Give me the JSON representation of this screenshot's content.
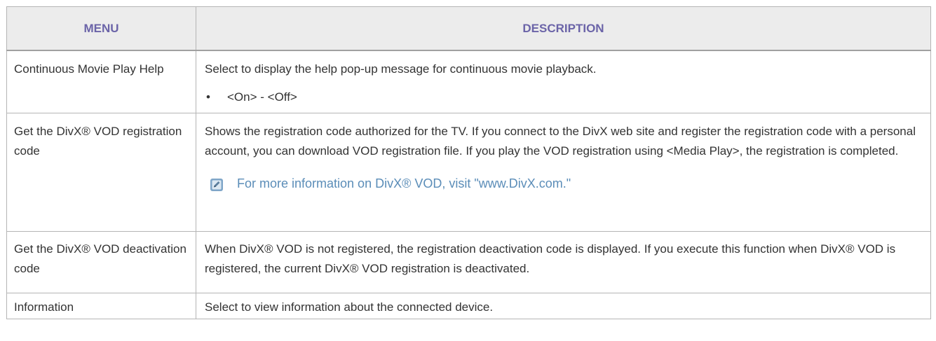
{
  "table": {
    "headers": {
      "menu": "MENU",
      "description": "DESCRIPTION"
    },
    "rows": [
      {
        "menu": "Continuous Movie Play Help",
        "description": "Select to display the help pop-up message for continuous movie playback.",
        "bullet_symbol": "•",
        "bullet": "<On> - <Off>"
      },
      {
        "menu": "Get the DivX® VOD registration code",
        "description": "Shows the registration code authorized for the TV. If you connect to the DivX web site and register the registration code with a personal account, you can download VOD registration file. If you play the VOD registration using <Media Play>, the registration is completed.",
        "note": "For more information on DivX® VOD, visit \"www.DivX.com.\""
      },
      {
        "menu": "Get the DivX® VOD deactivation code",
        "description": "When DivX® VOD is not registered, the registration deactivation code is displayed. If you execute this function when DivX® VOD is registered, the current DivX® VOD registration is deactivated."
      },
      {
        "menu": "Information",
        "description": "Select to view information about the connected device."
      }
    ]
  },
  "colors": {
    "header_text": "#6b64a8",
    "header_bg": "#ececec",
    "note_text": "#5b8db8",
    "border": "#b5b5b5"
  },
  "icons": {
    "note": "note-pencil-icon"
  }
}
